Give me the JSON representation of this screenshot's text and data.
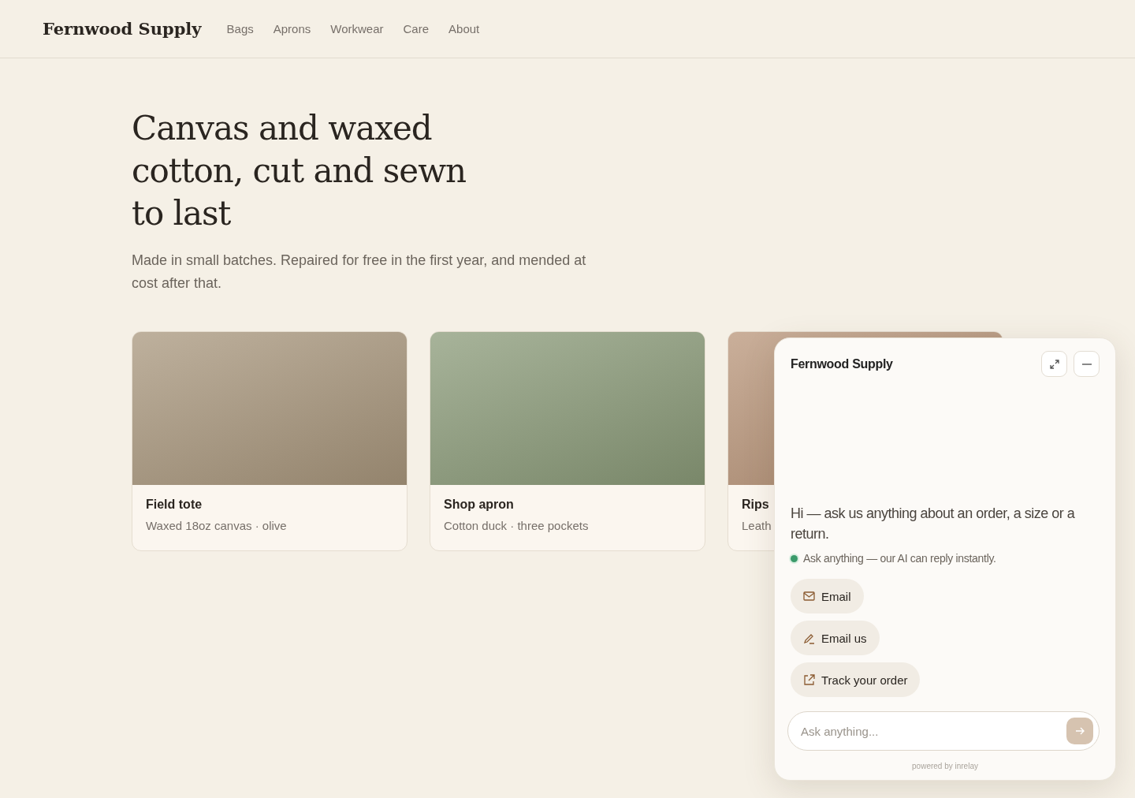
{
  "header": {
    "logo": "Fernwood Supply",
    "nav": [
      "Bags",
      "Aprons",
      "Workwear",
      "Care",
      "About"
    ]
  },
  "hero": {
    "title": "Canvas and waxed cotton, cut and sewn to last",
    "subtitle": "Made in small batches. Repaired for free in the first year, and mended at cost after that."
  },
  "products": [
    {
      "name": "Field tote",
      "detail": "Waxed 18oz canvas · olive",
      "color": "#a8967c"
    },
    {
      "name": "Shop apron",
      "detail": "Cotton duck · three pockets",
      "color": "#8a9a78"
    },
    {
      "name": "Rips",
      "detail": "Leath",
      "color": "#b89478"
    }
  ],
  "chat": {
    "title": "Fernwood Supply",
    "greeting": "Hi — ask us anything about an order, a size or a return.",
    "status": "Ask anything — our AI can reply instantly.",
    "online": true,
    "actions": [
      {
        "kind": "mail",
        "label": "Email"
      },
      {
        "kind": "pen",
        "label": "Email us"
      },
      {
        "kind": "external",
        "label": "Track your order"
      }
    ],
    "input": {
      "placeholder": "Ask anything..."
    },
    "footer": "powered by inrelay"
  }
}
